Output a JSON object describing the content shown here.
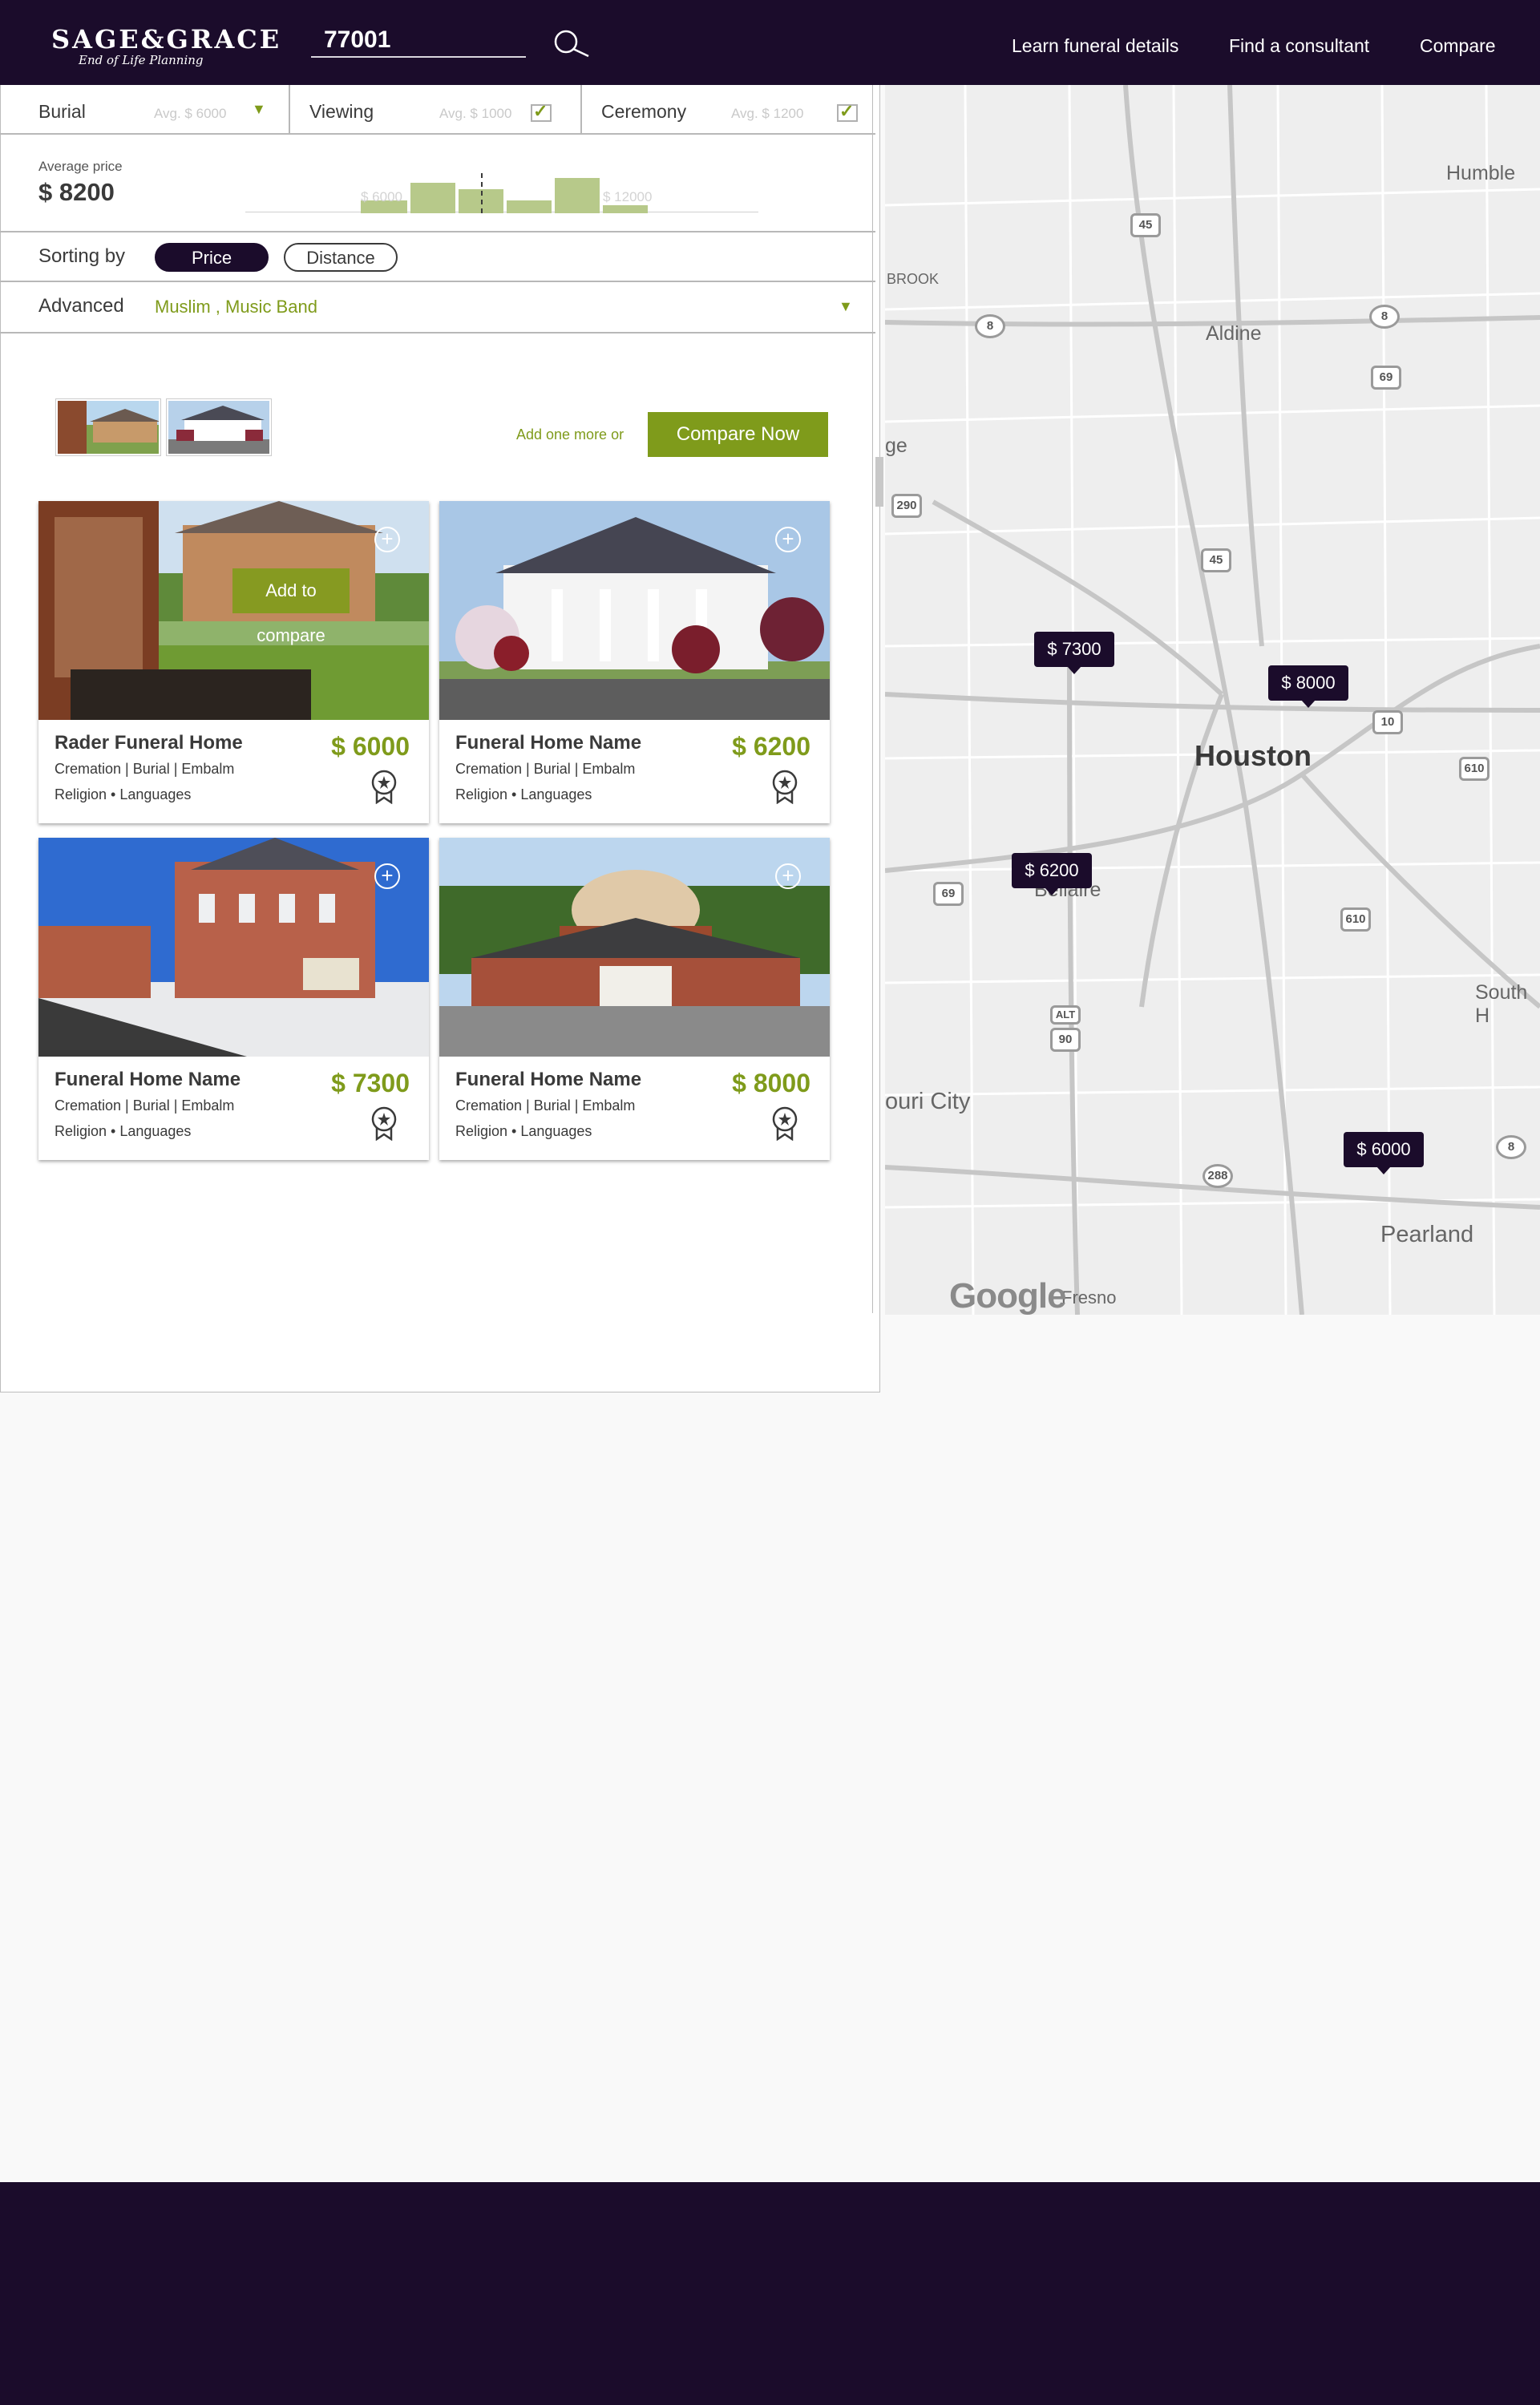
{
  "header": {
    "logo_main": "SAGE&GRACE",
    "logo_sub": "End of Life Planning",
    "search_value": "77001",
    "nav": [
      "Learn funeral details",
      "Find a consultant",
      "Compare"
    ]
  },
  "filters": [
    {
      "name": "Burial",
      "avg": "Avg. $ 6000"
    },
    {
      "name": "Viewing",
      "avg": "Avg. $ 1000"
    },
    {
      "name": "Ceremony",
      "avg": "Avg. $ 1200"
    }
  ],
  "average": {
    "label": "Average price",
    "value": "$ 8200",
    "range_min": "$ 6000",
    "range_max": "$ 12000"
  },
  "sorting": {
    "label": "Sorting by",
    "options": [
      "Price",
      "Distance"
    ],
    "active": "Price"
  },
  "advanced": {
    "label": "Advanced",
    "value": "Muslim , Music Band"
  },
  "compare": {
    "add_more": "Add one more or",
    "button": "Compare Now",
    "overlay": "Add to compare"
  },
  "cards": [
    {
      "name": "Rader Funeral Home",
      "price": "$ 6000",
      "services": "Cremation | Burial | Embalm",
      "meta": "Religion • Languages"
    },
    {
      "name": "Funeral Home Name",
      "price": "$ 6200",
      "services": "Cremation | Burial | Embalm",
      "meta": "Religion • Languages"
    },
    {
      "name": "Funeral Home Name",
      "price": "$ 7300",
      "services": "Cremation | Burial | Embalm",
      "meta": "Religion • Languages"
    },
    {
      "name": "Funeral Home Name",
      "price": "$ 8000",
      "services": "Cremation | Burial | Embalm",
      "meta": "Religion • Languages"
    }
  ],
  "map": {
    "city": "Houston",
    "labels": [
      "Humble",
      "Aldine",
      "BROOK",
      "ge",
      "Bellaire",
      "South H",
      "ouri City",
      "Pearland",
      "Fresno"
    ],
    "pins": [
      "$ 7300",
      "$ 8000",
      "$ 6200",
      "$ 6000"
    ],
    "shields": [
      "45",
      "8",
      "8",
      "69",
      "290",
      "45",
      "10",
      "610",
      "69",
      "610",
      "90",
      "ALT",
      "288",
      "8"
    ],
    "attribution": "Google"
  },
  "colors": {
    "primary": "#1b0c2b",
    "accent": "#7f9b1b"
  }
}
